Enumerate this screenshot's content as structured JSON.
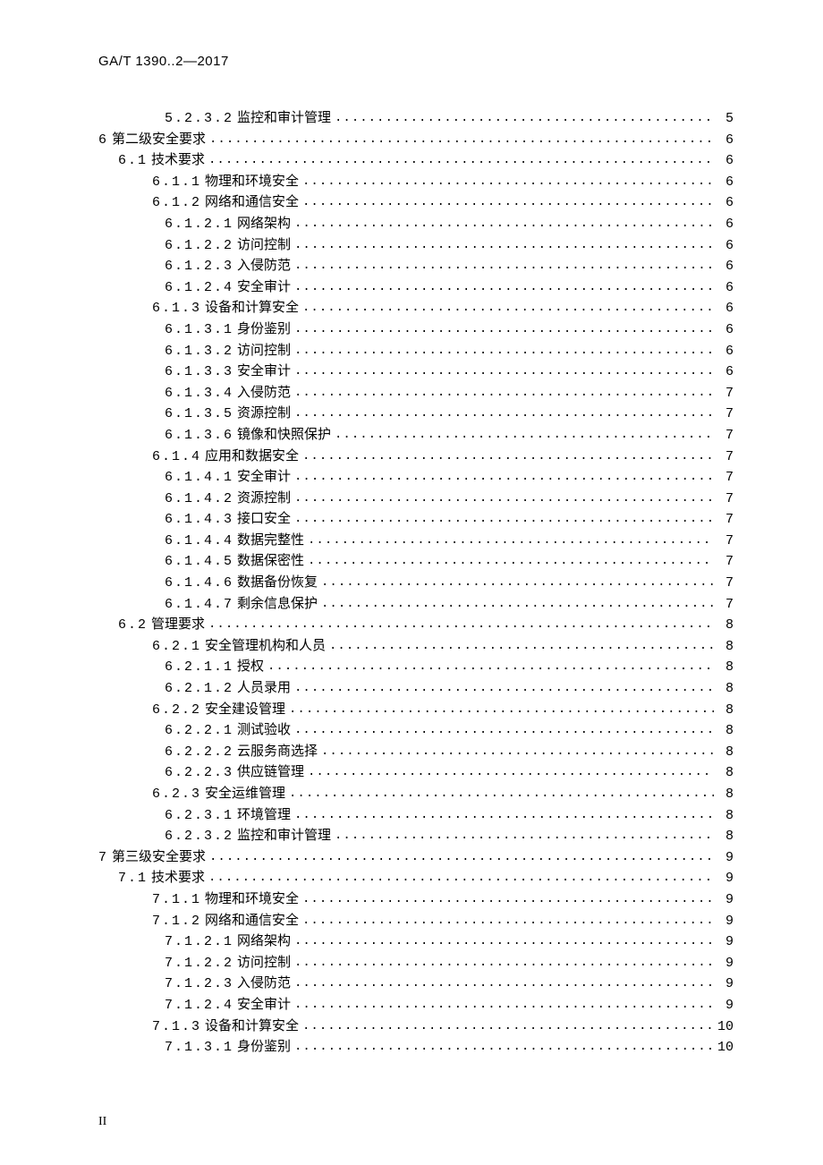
{
  "doc_id": "GA/T 1390..2—2017",
  "footer_page": "II",
  "toc": [
    {
      "indent": 4,
      "num": "5.2.3.2",
      "title": "监控和审计管理",
      "page": "5"
    },
    {
      "indent": 0,
      "num": "6",
      "title": "第二级安全要求",
      "page": "6"
    },
    {
      "indent": 1,
      "num": "6.1",
      "title": "技术要求",
      "page": "6"
    },
    {
      "indent": 3,
      "num": "6.1.1",
      "title": "物理和环境安全",
      "page": "6"
    },
    {
      "indent": 3,
      "num": "6.1.2",
      "title": "网络和通信安全",
      "page": "6"
    },
    {
      "indent": 4,
      "num": "6.1.2.1",
      "title": "网络架构",
      "page": "6"
    },
    {
      "indent": 4,
      "num": "6.1.2.2",
      "title": "访问控制",
      "page": "6"
    },
    {
      "indent": 4,
      "num": "6.1.2.3",
      "title": "入侵防范",
      "page": "6"
    },
    {
      "indent": 4,
      "num": "6.1.2.4",
      "title": "安全审计",
      "page": "6"
    },
    {
      "indent": 3,
      "num": "6.1.3",
      "title": "设备和计算安全",
      "page": "6"
    },
    {
      "indent": 4,
      "num": "6.1.3.1",
      "title": "身份鉴别",
      "page": "6"
    },
    {
      "indent": 4,
      "num": "6.1.3.2",
      "title": "访问控制",
      "page": "6"
    },
    {
      "indent": 4,
      "num": "6.1.3.3",
      "title": "安全审计",
      "page": "6"
    },
    {
      "indent": 4,
      "num": "6.1.3.4",
      "title": "入侵防范",
      "page": "7"
    },
    {
      "indent": 4,
      "num": "6.1.3.5",
      "title": "资源控制",
      "page": "7"
    },
    {
      "indent": 4,
      "num": "6.1.3.6",
      "title": "镜像和快照保护",
      "page": "7"
    },
    {
      "indent": 3,
      "num": "6.1.4",
      "title": "应用和数据安全",
      "page": "7"
    },
    {
      "indent": 4,
      "num": "6.1.4.1",
      "title": "安全审计",
      "page": "7"
    },
    {
      "indent": 4,
      "num": "6.1.4.2",
      "title": "资源控制",
      "page": "7"
    },
    {
      "indent": 4,
      "num": "6.1.4.3",
      "title": "接口安全",
      "page": "7"
    },
    {
      "indent": 4,
      "num": "6.1.4.4",
      "title": "数据完整性",
      "page": "7"
    },
    {
      "indent": 4,
      "num": "6.1.4.5",
      "title": "数据保密性",
      "page": "7"
    },
    {
      "indent": 4,
      "num": "6.1.4.6",
      "title": "数据备份恢复",
      "page": "7"
    },
    {
      "indent": 4,
      "num": "6.1.4.7",
      "title": "剩余信息保护",
      "page": "7"
    },
    {
      "indent": 1,
      "num": "6.2",
      "title": "管理要求",
      "page": "8"
    },
    {
      "indent": 3,
      "num": "6.2.1",
      "title": "安全管理机构和人员",
      "page": "8"
    },
    {
      "indent": 4,
      "num": "6.2.1.1",
      "title": "授权",
      "page": "8"
    },
    {
      "indent": 4,
      "num": "6.2.1.2",
      "title": "人员录用",
      "page": "8"
    },
    {
      "indent": 3,
      "num": "6.2.2",
      "title": "安全建设管理",
      "page": "8"
    },
    {
      "indent": 4,
      "num": "6.2.2.1",
      "title": "测试验收",
      "page": "8"
    },
    {
      "indent": 4,
      "num": "6.2.2.2",
      "title": "云服务商选择",
      "page": "8"
    },
    {
      "indent": 4,
      "num": "6.2.2.3",
      "title": "供应链管理",
      "page": "8"
    },
    {
      "indent": 3,
      "num": "6.2.3",
      "title": "安全运维管理",
      "page": "8"
    },
    {
      "indent": 4,
      "num": "6.2.3.1",
      "title": "环境管理",
      "page": "8"
    },
    {
      "indent": 4,
      "num": "6.2.3.2",
      "title": "监控和审计管理",
      "page": "8"
    },
    {
      "indent": 0,
      "num": "7",
      "title": "第三级安全要求",
      "page": "9"
    },
    {
      "indent": 1,
      "num": "7.1",
      "title": "技术要求",
      "page": "9"
    },
    {
      "indent": 3,
      "num": "7.1.1",
      "title": "物理和环境安全",
      "page": "9"
    },
    {
      "indent": 3,
      "num": "7.1.2",
      "title": "网络和通信安全",
      "page": "9"
    },
    {
      "indent": 4,
      "num": "7.1.2.1",
      "title": "网络架构",
      "page": "9"
    },
    {
      "indent": 4,
      "num": "7.1.2.2",
      "title": "访问控制",
      "page": "9"
    },
    {
      "indent": 4,
      "num": "7.1.2.3",
      "title": "入侵防范",
      "page": "9"
    },
    {
      "indent": 4,
      "num": "7.1.2.4",
      "title": "安全审计",
      "page": "9"
    },
    {
      "indent": 3,
      "num": "7.1.3",
      "title": "设备和计算安全",
      "page": "10"
    },
    {
      "indent": 4,
      "num": "7.1.3.1",
      "title": "身份鉴别",
      "page": "10"
    }
  ]
}
